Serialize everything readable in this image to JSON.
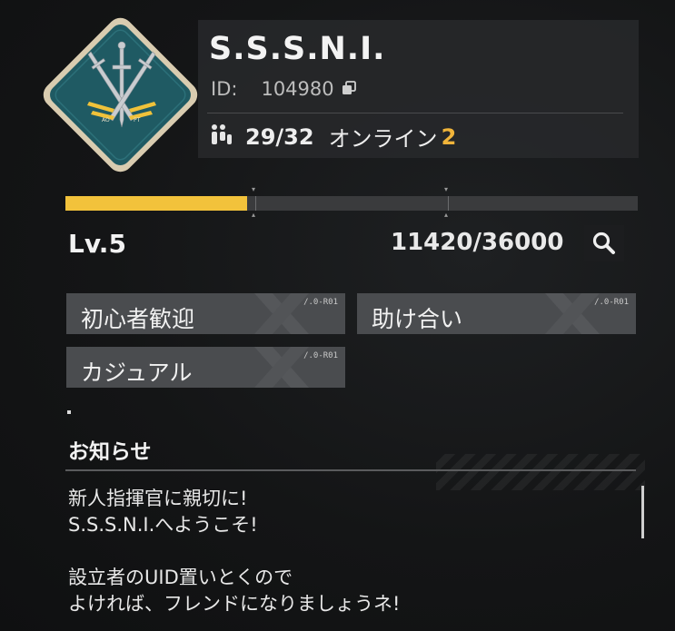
{
  "guild": {
    "name": "S.S.S.N.I.",
    "id_label": "ID:",
    "id_value": "104980",
    "members": "29/32",
    "online_label": "オンライン",
    "online_count": "2",
    "emblem_text_left": "AO",
    "emblem_text_right": "PT"
  },
  "level": {
    "label": "Lv.5",
    "exp": "11420/36000",
    "exp_fraction": 0.317
  },
  "tags": [
    {
      "label": "初心者歓迎",
      "code": "/.0-R01"
    },
    {
      "label": "助け合い",
      "code": "/.0-R01"
    },
    {
      "label": "カジュアル",
      "code": "/.0-R01"
    }
  ],
  "notice": {
    "title": "お知らせ",
    "body": "新人指揮官に親切に!\nS.S.S.N.I.へようこそ!\n\n設立者のUID置いとくので\nよければ、フレンドになりましょうネ!"
  },
  "colors": {
    "accent": "#f2c23b",
    "online": "#f0b43a",
    "emblem_bg": "#1f5a63",
    "emblem_border": "#d9ccb0"
  },
  "icons": {
    "copy": "copy-icon",
    "members": "members-icon",
    "search": "search-icon"
  }
}
